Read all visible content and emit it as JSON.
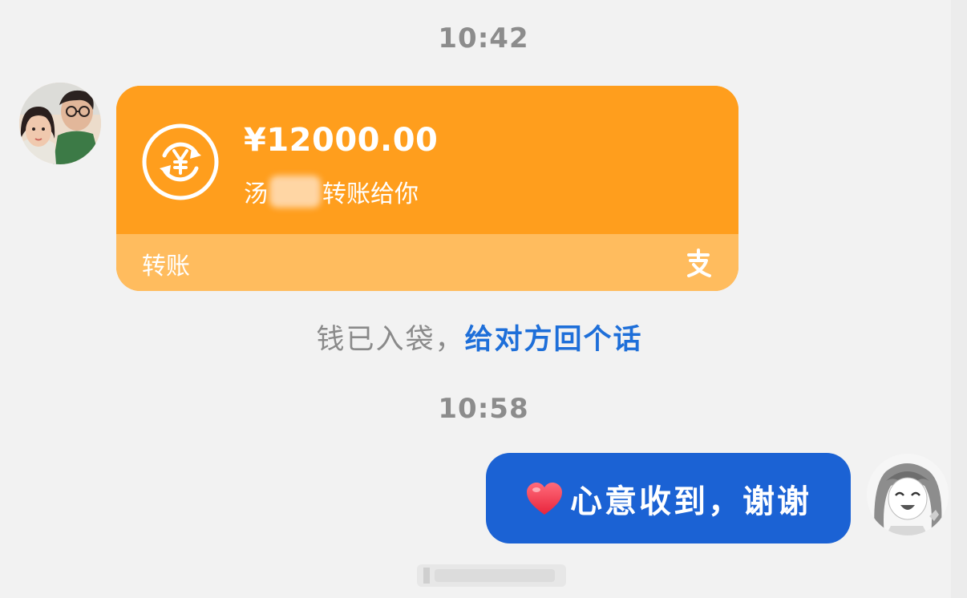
{
  "timestamps": [
    "10:42",
    "10:58"
  ],
  "transfer_card": {
    "amount": "¥12000.00",
    "sender_prefix": "汤",
    "sender_suffix": "转账给你",
    "label": "转账",
    "card_color": "#ff9e1d",
    "footer_color": "#ffbc5e",
    "icon": "yuan-exchange-icon",
    "brand_icon": "alipay-icon"
  },
  "system_message": {
    "text": "钱已入袋，",
    "link": "给对方回个话",
    "link_color": "#1e6fd9"
  },
  "reply_message": {
    "emoji": "heart-icon",
    "text": "心意收到，谢谢",
    "bubble_color": "#1b62d4"
  }
}
